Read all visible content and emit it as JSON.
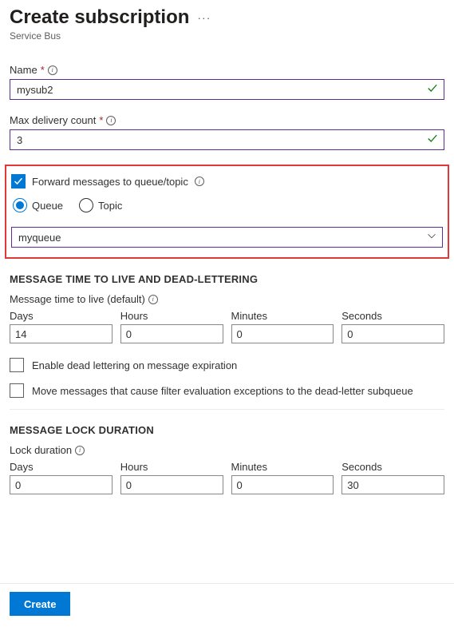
{
  "header": {
    "title": "Create subscription",
    "subtitle": "Service Bus",
    "menu": "···"
  },
  "name_field": {
    "label": "Name",
    "value": "mysub2"
  },
  "max_delivery": {
    "label": "Max delivery count",
    "value": "3"
  },
  "forward": {
    "checkbox_label": "Forward messages to queue/topic",
    "queue_label": "Queue",
    "topic_label": "Topic",
    "selected_value": "myqueue"
  },
  "ttl_section": {
    "heading": "MESSAGE TIME TO LIVE AND DEAD-LETTERING",
    "ttl_label": "Message time to live (default)",
    "days_label": "Days",
    "hours_label": "Hours",
    "minutes_label": "Minutes",
    "seconds_label": "Seconds",
    "days": "14",
    "hours": "0",
    "minutes": "0",
    "seconds": "0",
    "dead_letter_label": "Enable dead lettering on message expiration",
    "filter_exception_label": "Move messages that cause filter evaluation exceptions to the dead-letter subqueue"
  },
  "lock_section": {
    "heading": "MESSAGE LOCK DURATION",
    "lock_label": "Lock duration",
    "days_label": "Days",
    "hours_label": "Hours",
    "minutes_label": "Minutes",
    "seconds_label": "Seconds",
    "days": "0",
    "hours": "0",
    "minutes": "0",
    "seconds": "30"
  },
  "footer": {
    "create_label": "Create"
  }
}
